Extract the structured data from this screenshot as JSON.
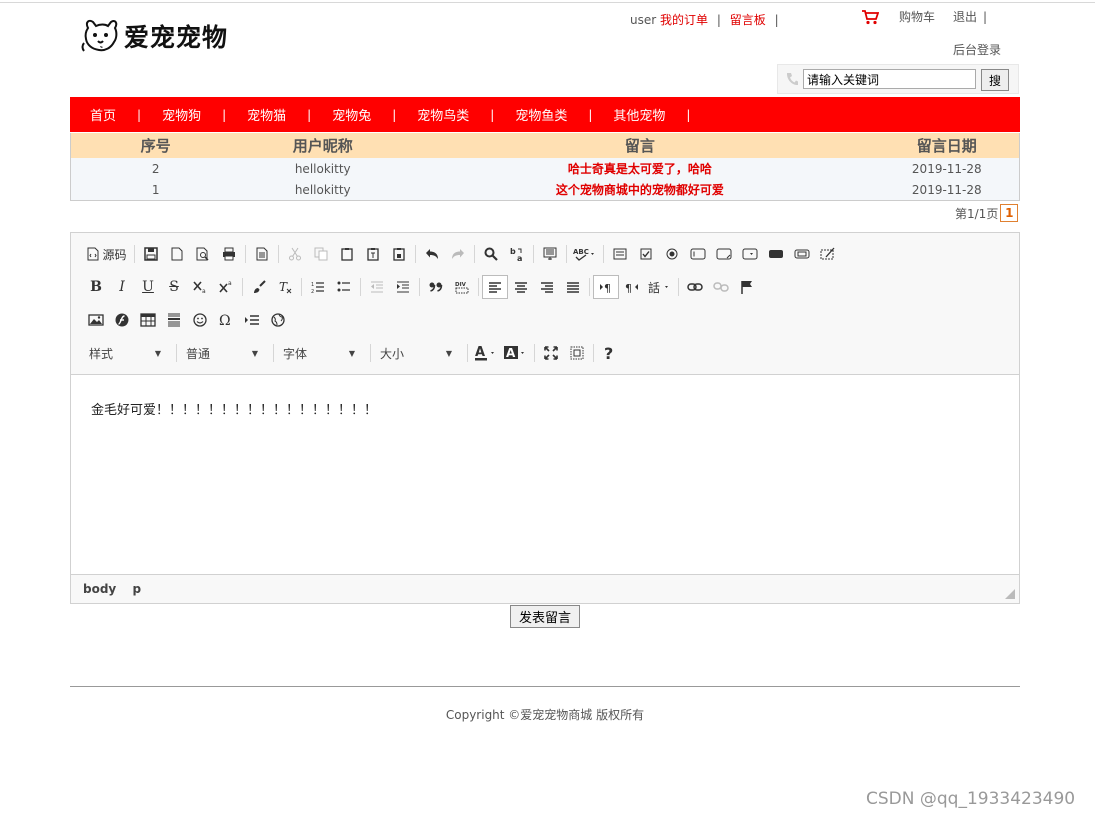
{
  "site": {
    "name": "爱宠宠物"
  },
  "header": {
    "user": "user",
    "my_orders": "我的订单",
    "message_board": "留言板",
    "separator": "|",
    "cart": "购物车",
    "logout": "退出",
    "admin_login": "后台登录"
  },
  "search": {
    "value": "请输入关键词",
    "button": "搜"
  },
  "nav": {
    "items": [
      "首页",
      "宠物狗",
      "宠物猫",
      "宠物兔",
      "宠物鸟类",
      "宠物鱼类",
      "其他宠物"
    ],
    "separator": "|"
  },
  "table": {
    "headers": [
      "序号",
      "用户昵称",
      "留言",
      "留言日期"
    ],
    "rows": [
      [
        "2",
        "hellokitty",
        "哈士奇真是太可爱了，哈哈",
        "2019-11-28"
      ],
      [
        "1",
        "hellokitty",
        "这个宠物商城中的宠物都好可爱",
        "2019-11-28"
      ]
    ]
  },
  "pager": {
    "label": "第1/1页",
    "current": "1"
  },
  "editor": {
    "source_label": "源码",
    "combos": [
      "样式",
      "普通",
      "字体",
      "大小"
    ],
    "content": "金毛好可爱！！！！！！！！！！！！！！！！！",
    "path": [
      "body",
      "p"
    ]
  },
  "submit": {
    "label": "发表留言"
  },
  "footer": {
    "copyright": "Copyright ©爱宠宠物商城 版权所有"
  },
  "watermark": "CSDN @qq_1933423490",
  "colors": {
    "nav_bg": "#ff0000",
    "header_row_bg": "#ffe0b3",
    "accent_red": "#e00000"
  }
}
